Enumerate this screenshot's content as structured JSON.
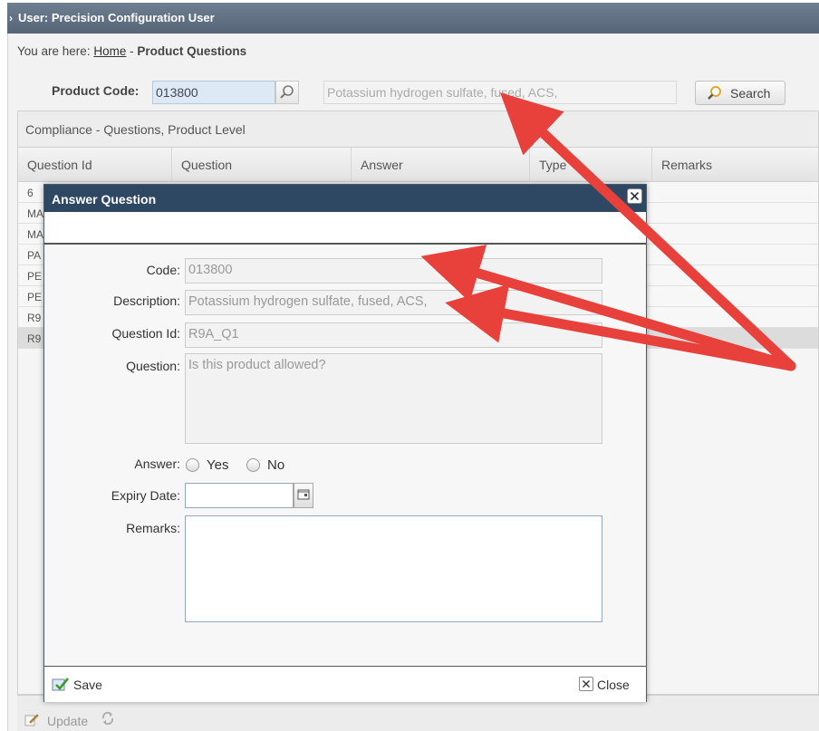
{
  "window": {
    "title": "User: Precision Configuration User"
  },
  "breadcrumb": {
    "prefix": "You are here:",
    "home": "Home",
    "separator": "-",
    "current": "Product Questions"
  },
  "product": {
    "code_label": "Product Code:",
    "code_value": "013800",
    "description": "Potassium hydrogen sulfate, fused, ACS,",
    "search_label": "Search"
  },
  "grid": {
    "title": "Compliance - Questions, Product Level",
    "columns": [
      "Question Id",
      "Question",
      "Answer",
      "Type",
      "Remarks"
    ],
    "rows": [
      "6",
      "MA",
      "MA",
      "PA",
      "PE",
      "PE",
      "R9",
      "R9"
    ]
  },
  "dialog": {
    "title": "Answer Question",
    "code_label": "Code:",
    "code_value": "013800",
    "description_label": "Description:",
    "description_value": "Potassium hydrogen sulfate, fused, ACS,",
    "question_id_label": "Question Id:",
    "question_id_value": "R9A_Q1",
    "question_label": "Question:",
    "question_value": "Is this product allowed?",
    "answer_label": "Answer:",
    "answer_yes": "Yes",
    "answer_no": "No",
    "expiry_label": "Expiry Date:",
    "expiry_value": "",
    "remarks_label": "Remarks:",
    "remarks_value": "",
    "save_label": "Save",
    "close_label": "Close"
  },
  "toolbar": {
    "update_label": "Update"
  },
  "colors": {
    "title_bar": "#556577",
    "dialog_title": "#2e4763",
    "arrow": "#e8403a"
  }
}
